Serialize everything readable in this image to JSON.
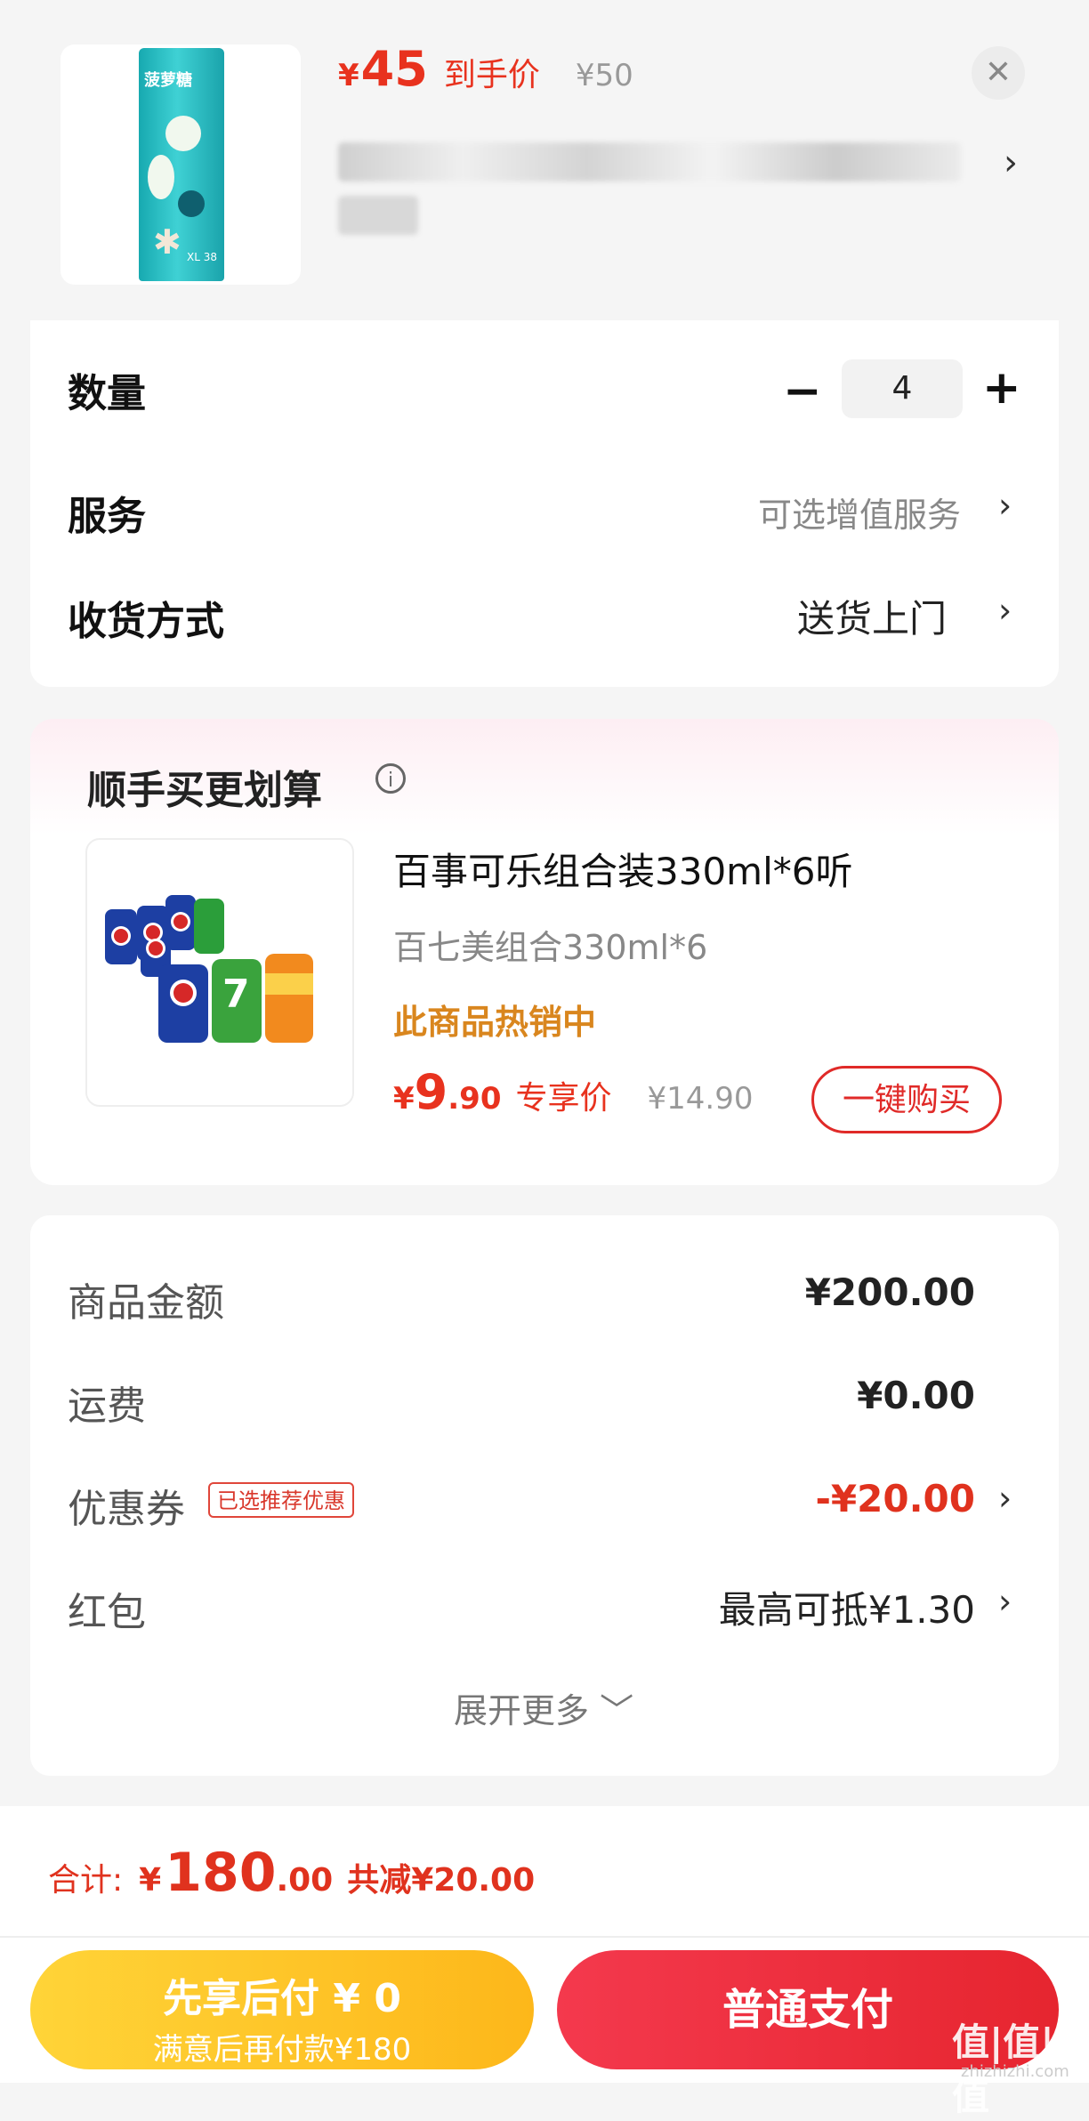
{
  "product": {
    "currency": "¥",
    "price": "45",
    "price_tag": "到手价",
    "original_price": "¥50",
    "can_brand": "菠萝糖",
    "can_size": "XL 38",
    "close_icon": "close-icon"
  },
  "options": {
    "quantity_label": "数量",
    "quantity_value": "4",
    "minus": "−",
    "plus": "+",
    "service_label": "服务",
    "service_value": "可选增值服务",
    "delivery_label": "收货方式",
    "delivery_value": "送货上门"
  },
  "upsell": {
    "title": "顺手买更划算",
    "info_icon": "i",
    "name": "百事可乐组合装330ml*6听",
    "subtitle": "百七美组合330ml*6",
    "hot": "此商品热销中",
    "currency": "¥",
    "price_int": "9",
    "price_dec": ".90",
    "price_tag": "专享价",
    "original_price": "¥14.90",
    "buy_button": "一键购买"
  },
  "summary": {
    "goods_label": "商品金额",
    "goods_value": "¥200.00",
    "shipping_label": "运费",
    "shipping_value": "¥0.00",
    "coupon_label": "优惠券",
    "coupon_badge": "已选推荐优惠",
    "coupon_value": "-¥20.00",
    "redpacket_label": "红包",
    "redpacket_value": "最高可抵¥1.30",
    "expand": "展开更多 ﹀"
  },
  "bottom": {
    "total_label": "合计:",
    "total_currency": "¥",
    "total_int": "180",
    "total_dec": ".00",
    "saved": "共减¥20.00",
    "pay_later_title": "先享后付 ¥ 0",
    "pay_later_sub": "满意后再付款¥180",
    "pay_normal": "普通支付",
    "watermark": "值|值|值",
    "watermark_sub": "zhizhizhi.com"
  },
  "colors": {
    "accent_red": "#e8321e",
    "pay_yellow": "#fdb71a",
    "pay_red": "#e6252f",
    "hot_orange": "#d9861e"
  },
  "chevron": "›"
}
